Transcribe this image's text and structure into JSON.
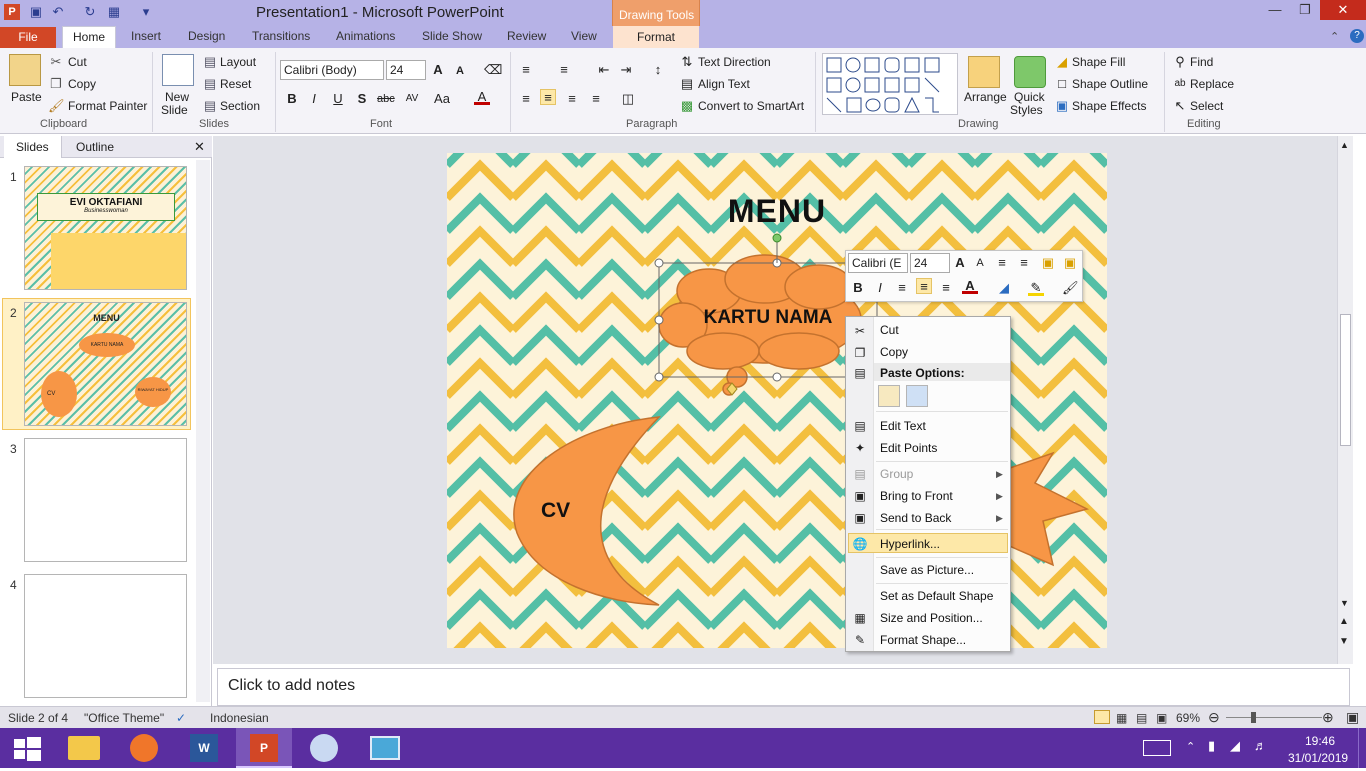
{
  "window": {
    "title": "Presentation1 - Microsoft PowerPoint",
    "context_group": "Drawing Tools"
  },
  "tabs": {
    "file": "File",
    "home": "Home",
    "insert": "Insert",
    "design": "Design",
    "transitions": "Transitions",
    "animations": "Animations",
    "slideshow": "Slide Show",
    "review": "Review",
    "view": "View",
    "format": "Format"
  },
  "ribbon": {
    "clipboard": {
      "group": "Clipboard",
      "paste": "Paste",
      "cut": "Cut",
      "copy": "Copy",
      "format_painter": "Format Painter"
    },
    "slides": {
      "group": "Slides",
      "new_slide_1": "New",
      "new_slide_2": "Slide",
      "layout": "Layout",
      "reset": "Reset",
      "section": "Section"
    },
    "font": {
      "group": "Font",
      "name": "Calibri (Body)",
      "size": "24"
    },
    "paragraph": {
      "group": "Paragraph",
      "text_direction": "Text Direction",
      "align_text": "Align Text",
      "smartart": "Convert to SmartArt"
    },
    "drawing": {
      "group": "Drawing",
      "arrange": "Arrange",
      "quick_styles_1": "Quick",
      "quick_styles_2": "Styles",
      "shape_fill": "Shape Fill",
      "shape_outline": "Shape Outline",
      "shape_effects": "Shape Effects"
    },
    "editing": {
      "group": "Editing",
      "find": "Find",
      "replace": "Replace",
      "select": "Select"
    }
  },
  "panes": {
    "slides_tab": "Slides",
    "outline_tab": "Outline"
  },
  "thumbnails": [
    {
      "num": "1",
      "title": "EVI OKTAFIANI",
      "subtitle": "Businesswoman"
    },
    {
      "num": "2",
      "title": "MENU",
      "kartu": "KARTU NAMA",
      "cv": "CV",
      "riwayat": "RIWAYAT HIDUP"
    },
    {
      "num": "3"
    },
    {
      "num": "4"
    }
  ],
  "slide": {
    "title": "MENU",
    "cloud_text": "KARTU NAMA",
    "moon_text": "CV"
  },
  "mini_toolbar": {
    "font": "Calibri (E",
    "size": "24"
  },
  "context_menu": {
    "cut": "Cut",
    "copy": "Copy",
    "paste_options": "Paste Options:",
    "edit_text": "Edit Text",
    "edit_points": "Edit Points",
    "group": "Group",
    "bring_front": "Bring to Front",
    "send_back": "Send to Back",
    "hyperlink": "Hyperlink...",
    "save_picture": "Save as Picture...",
    "set_default": "Set as Default Shape",
    "size_position": "Size and Position...",
    "format_shape": "Format Shape..."
  },
  "notes": {
    "placeholder": "Click to add notes"
  },
  "status": {
    "slide": "Slide 2 of 4",
    "theme": "\"Office Theme\"",
    "language": "Indonesian",
    "zoom": "69%"
  },
  "taskbar": {
    "time": "19:46",
    "date": "31/01/2019"
  },
  "colors": {
    "accent_orange": "#f79646",
    "teal": "#54bfa6",
    "yellow": "#f3bf3e",
    "file_tab": "#d24726",
    "taskbar": "#5a2ea0"
  }
}
